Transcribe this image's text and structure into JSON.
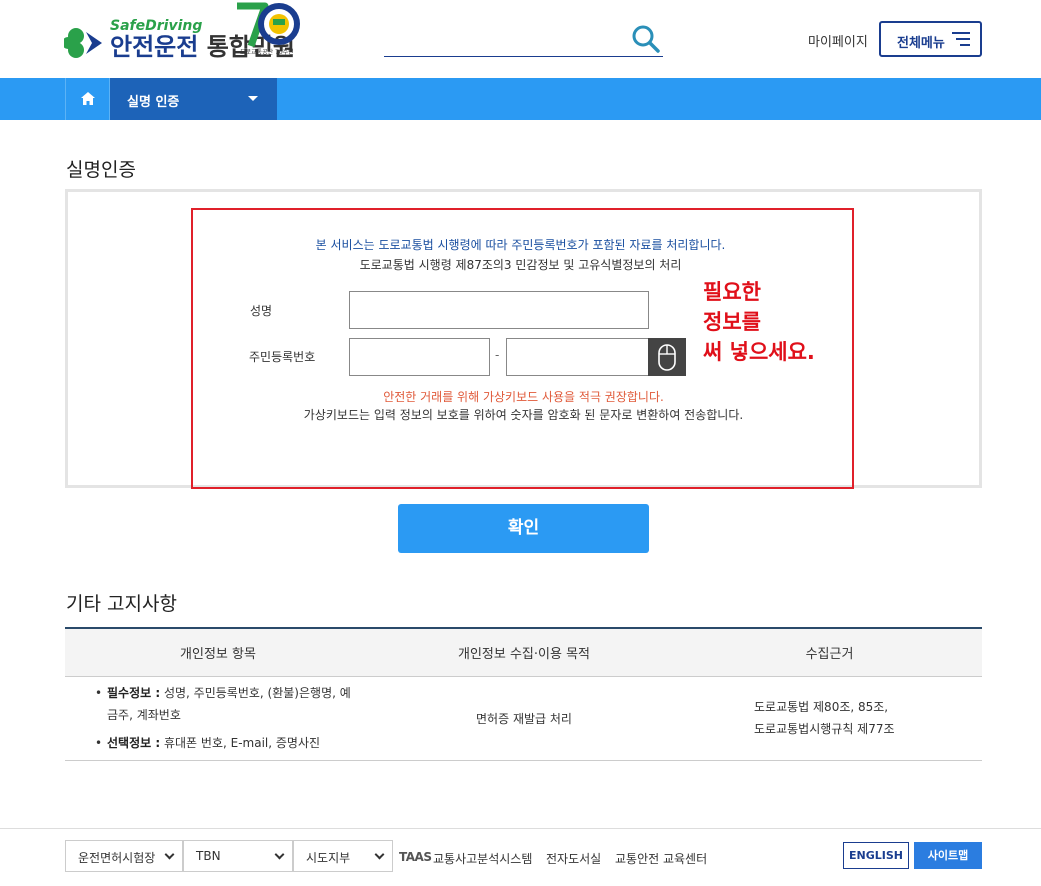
{
  "header": {
    "logo_en": "SafeDriving",
    "logo_ko_main": "안전운전",
    "logo_ko_sub": "통합민원",
    "anniv_caption": "도로교통공단 70주년",
    "mypage_label": "마이페이지",
    "allmenu_label": "전체메뉴"
  },
  "nav": {
    "current_label": "실명 인증"
  },
  "auth": {
    "title": "실명인증",
    "notice_line1": "본 서비스는 도로교통법 시행령에 따라 주민등록번호가 포함된 자료를 처리합니다.",
    "notice_line2": "도로교통법 시행령 제87조의3 민감정보 및 고유식별정보의 처리",
    "name_label": "성명",
    "rrn_label": "주민등록번호",
    "dash": "-",
    "warn": "안전한 거래를 위해 가상키보드 사용을 적극 권장합니다.",
    "info": "가상키보드는 입력 정보의 보호를 위하여 숫자를 암호화 된 문자로 변환하여 전송합니다.",
    "annotation_lines": [
      "필요한",
      "정보를",
      "써 넣으세요."
    ],
    "confirm_label": "확인"
  },
  "notices": {
    "title": "기타 고지사항",
    "headers": [
      "개인정보 항목",
      "개인정보 수집·이용 목적",
      "수집근거"
    ],
    "required_label": "필수정보 :",
    "required_text": "성명, 주민등록번호, (환불)은행명, 예금주, 계좌번호",
    "optional_label": "선택정보 :",
    "optional_text": "휴대폰 번호, E-mail, 증명사진",
    "purpose": "면허증 재발급 처리",
    "basis_line1": "도로교통법 제80조, 85조,",
    "basis_line2": "도로교통법시행규칙 제77조"
  },
  "footer": {
    "select1": "운전면허시험장",
    "select2": "TBN",
    "select3": "시도지부",
    "taas_logo": "TAAS",
    "link_taas": "교통사고분석시스템",
    "link_library": "전자도서실",
    "link_edu": "교통안전 교육센터",
    "btn_english": "ENGLISH",
    "btn_sitemap": "사이트맵"
  },
  "colors": {
    "brand_navy": "#1a3d8f",
    "nav_blue": "#2b9af3",
    "nav_dark": "#1d63b8",
    "annotation_red": "#e0101a"
  }
}
